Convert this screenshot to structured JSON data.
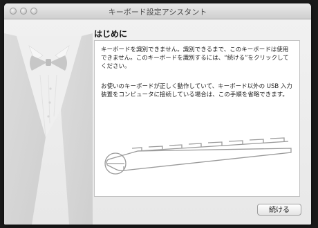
{
  "window": {
    "title": "キーボード設定アシスタント"
  },
  "page": {
    "heading": "はじめに",
    "paragraph1": "キーボードを識別できません。識別できるまで、このキーボードは使用できません。このキーボードを識別するには、“続ける”をクリックしてください。",
    "paragraph2": "お使いのキーボードが正しく動作していて、キーボード以外の USB 入力装置をコンピュータに接続している場合は、この手順を省略できます。"
  },
  "buttons": {
    "continue_label": "続ける"
  },
  "icons": {
    "sidebar_art": "tuxedo-illustration",
    "keyboard_art": "keyboard-illustration"
  }
}
